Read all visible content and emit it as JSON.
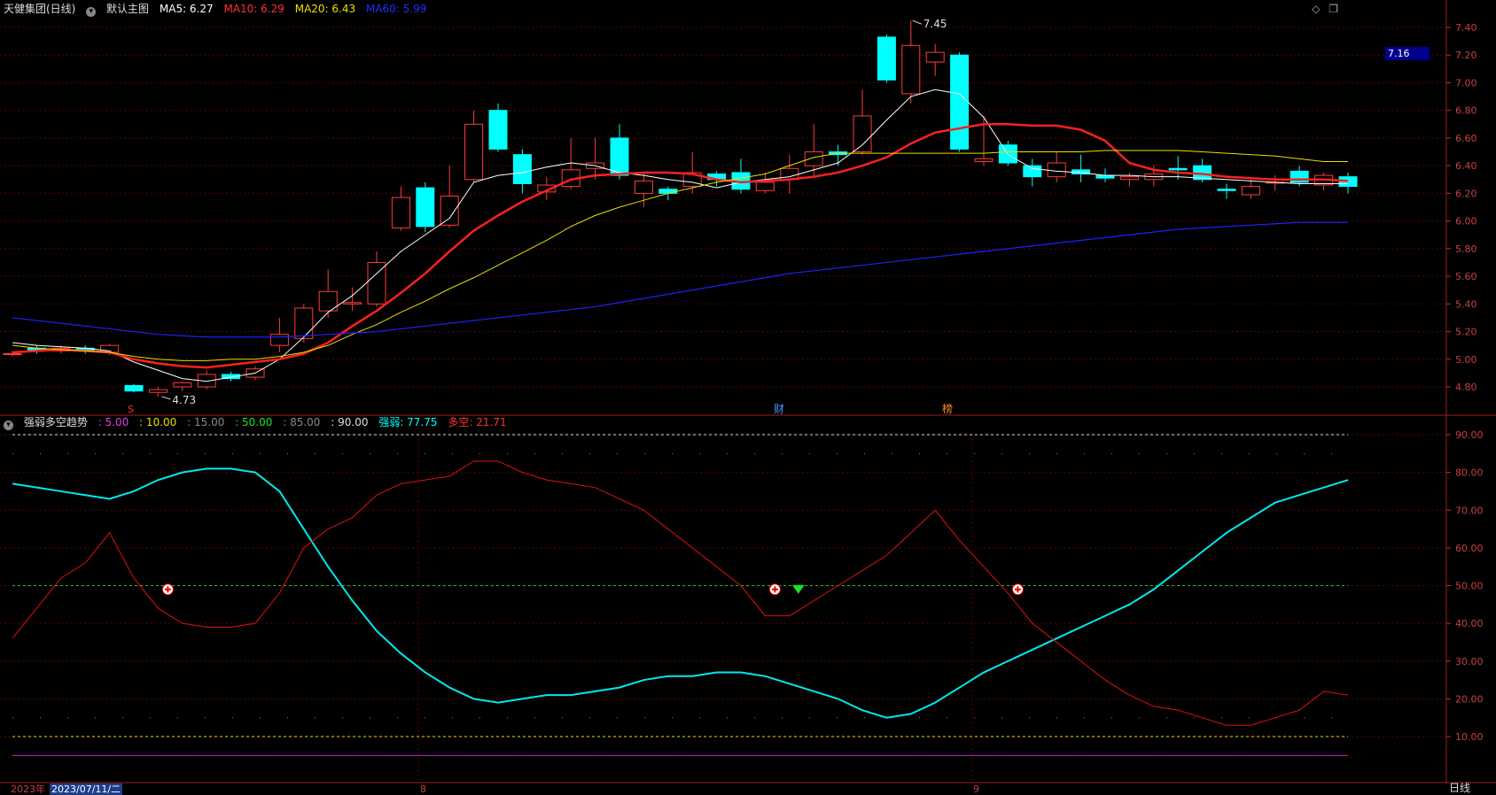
{
  "main_header": {
    "stock": "天健集团(日线)",
    "template": "默认主图",
    "ma5": "MA5: 6.27",
    "ma10": "MA10: 6.29",
    "ma20": "MA20: 6.43",
    "ma60": "MA60: 5.99"
  },
  "sub_header": {
    "title": "强弱多空趋势",
    "v1": ": 5.00",
    "v2": ": 10.00",
    "v3": ": 15.00",
    "v4": ": 50.00",
    "v5": ": 85.00",
    "v6": ": 90.00",
    "strength": "强弱: 77.75",
    "longshort": "多空: 21.71"
  },
  "bottom_axis": {
    "year_label": "2023年",
    "date_cursor": "2023/07/11/二",
    "aug": "8",
    "sep": "9"
  },
  "current_price": "7.16",
  "period_label": "日线",
  "corner_icons": [
    "diamond-icon",
    "restore-window-icon"
  ],
  "colors": {
    "up": "#ff3b3b",
    "down": "#00ffff",
    "ma5": "#ffffff",
    "ma10": "#ff2020",
    "ma20": "#e8e000",
    "ma60": "#2020ff"
  },
  "chart_data": [
    {
      "type": "candlestick",
      "ylim": [
        4.6,
        7.5
      ],
      "yticks": [
        "7.40",
        "7.20",
        "7.00",
        "6.80",
        "6.60",
        "6.40",
        "6.20",
        "6.00",
        "5.80",
        "5.60",
        "5.40",
        "5.20",
        "5.00",
        "4.80"
      ],
      "annotations": {
        "high": "7.45",
        "low": "4.73",
        "finance_marker": "财",
        "rank_marker": "榜",
        "s_marker": "S"
      },
      "candles": [
        [
          5.04,
          5.04,
          5.02,
          5.06
        ],
        [
          5.08,
          5.06,
          5.04,
          5.1
        ],
        [
          5.06,
          5.08,
          5.04,
          5.1
        ],
        [
          5.08,
          5.06,
          5.04,
          5.1
        ],
        [
          5.05,
          5.1,
          5.03,
          5.11
        ],
        [
          4.81,
          4.77,
          4.76,
          4.82
        ],
        [
          4.76,
          4.78,
          4.73,
          4.8
        ],
        [
          4.8,
          4.83,
          4.77,
          4.84
        ],
        [
          4.8,
          4.89,
          4.78,
          4.92
        ],
        [
          4.89,
          4.86,
          4.84,
          4.91
        ],
        [
          4.87,
          4.93,
          4.85,
          4.95
        ],
        [
          5.1,
          5.18,
          5.05,
          5.3
        ],
        [
          5.15,
          5.37,
          5.12,
          5.4
        ],
        [
          5.35,
          5.49,
          5.3,
          5.65
        ],
        [
          5.4,
          5.41,
          5.35,
          5.52
        ],
        [
          5.4,
          5.7,
          5.38,
          5.78
        ],
        [
          5.95,
          6.17,
          5.93,
          6.25
        ],
        [
          6.24,
          5.96,
          5.92,
          6.28
        ],
        [
          5.97,
          6.18,
          5.95,
          6.4
        ],
        [
          6.3,
          6.7,
          6.28,
          6.8
        ],
        [
          6.8,
          6.52,
          6.5,
          6.85
        ],
        [
          6.48,
          6.27,
          6.2,
          6.52
        ],
        [
          6.21,
          6.26,
          6.15,
          6.32
        ],
        [
          6.25,
          6.37,
          6.23,
          6.6
        ],
        [
          6.38,
          6.42,
          6.3,
          6.6
        ],
        [
          6.6,
          6.33,
          6.3,
          6.7
        ],
        [
          6.2,
          6.29,
          6.1,
          6.35
        ],
        [
          6.23,
          6.2,
          6.15,
          6.25
        ],
        [
          6.25,
          6.35,
          6.2,
          6.5
        ],
        [
          6.34,
          6.3,
          6.25,
          6.36
        ],
        [
          6.35,
          6.23,
          6.2,
          6.45
        ],
        [
          6.22,
          6.28,
          6.2,
          6.35
        ],
        [
          6.3,
          6.38,
          6.2,
          6.48
        ],
        [
          6.4,
          6.5,
          6.32,
          6.7
        ],
        [
          6.5,
          6.48,
          6.4,
          6.55
        ],
        [
          6.5,
          6.76,
          6.48,
          6.95
        ],
        [
          7.33,
          7.02,
          7.0,
          7.35
        ],
        [
          6.92,
          7.27,
          6.85,
          7.45
        ],
        [
          7.15,
          7.22,
          7.05,
          7.28
        ],
        [
          7.2,
          6.52,
          6.5,
          7.22
        ],
        [
          6.43,
          6.45,
          6.4,
          6.76
        ],
        [
          6.55,
          6.42,
          6.4,
          6.58
        ],
        [
          6.4,
          6.32,
          6.25,
          6.45
        ],
        [
          6.32,
          6.42,
          6.28,
          6.5
        ],
        [
          6.37,
          6.34,
          6.28,
          6.48
        ],
        [
          6.33,
          6.31,
          6.28,
          6.38
        ],
        [
          6.3,
          6.32,
          6.25,
          6.35
        ],
        [
          6.3,
          6.34,
          6.25,
          6.4
        ],
        [
          6.38,
          6.37,
          6.3,
          6.47
        ],
        [
          6.4,
          6.3,
          6.28,
          6.45
        ],
        [
          6.23,
          6.22,
          6.16,
          6.27
        ],
        [
          6.19,
          6.25,
          6.16,
          6.3
        ],
        [
          6.28,
          6.28,
          6.22,
          6.33
        ],
        [
          6.36,
          6.28,
          6.25,
          6.4
        ],
        [
          6.26,
          6.33,
          6.22,
          6.35
        ],
        [
          6.32,
          6.25,
          6.2,
          6.35
        ]
      ],
      "series": [
        {
          "name": "MA5",
          "values": [
            5.12,
            5.1,
            5.09,
            5.08,
            5.06,
            4.98,
            4.92,
            4.86,
            4.84,
            4.87,
            4.9,
            5.0,
            5.16,
            5.34,
            5.46,
            5.62,
            5.78,
            5.9,
            6.02,
            6.28,
            6.33,
            6.35,
            6.39,
            6.42,
            6.4,
            6.35,
            6.33,
            6.3,
            6.28,
            6.24,
            6.28,
            6.3,
            6.32,
            6.37,
            6.42,
            6.55,
            6.73,
            6.9,
            6.95,
            6.92,
            6.75,
            6.48,
            6.38,
            6.36,
            6.35,
            6.33,
            6.33,
            6.32,
            6.32,
            6.31,
            6.3,
            6.29,
            6.28,
            6.27,
            6.27,
            6.27
          ]
        },
        {
          "name": "MA10",
          "values": [
            5.05,
            5.06,
            5.07,
            5.06,
            5.05,
            5.0,
            4.97,
            4.95,
            4.94,
            4.96,
            4.98,
            5.0,
            5.04,
            5.12,
            5.24,
            5.35,
            5.48,
            5.62,
            5.78,
            5.93,
            6.04,
            6.14,
            6.22,
            6.3,
            6.33,
            6.34,
            6.35,
            6.35,
            6.34,
            6.3,
            6.28,
            6.29,
            6.3,
            6.32,
            6.35,
            6.4,
            6.46,
            6.56,
            6.64,
            6.67,
            6.7,
            6.7,
            6.69,
            6.69,
            6.66,
            6.58,
            6.42,
            6.37,
            6.35,
            6.34,
            6.32,
            6.31,
            6.3,
            6.3,
            6.3,
            6.29
          ]
        },
        {
          "name": "MA20",
          "values": [
            5.1,
            5.08,
            5.07,
            5.06,
            5.05,
            5.02,
            5.0,
            4.99,
            4.99,
            5.0,
            5.0,
            5.02,
            5.05,
            5.1,
            5.18,
            5.25,
            5.34,
            5.42,
            5.51,
            5.59,
            5.68,
            5.77,
            5.86,
            5.96,
            6.04,
            6.1,
            6.15,
            6.2,
            6.24,
            6.28,
            6.31,
            6.34,
            6.4,
            6.46,
            6.49,
            6.49,
            6.49,
            6.49,
            6.49,
            6.49,
            6.49,
            6.5,
            6.5,
            6.5,
            6.5,
            6.51,
            6.51,
            6.51,
            6.51,
            6.5,
            6.49,
            6.48,
            6.47,
            6.45,
            6.43,
            6.43
          ]
        },
        {
          "name": "MA60",
          "values": [
            5.3,
            5.28,
            5.26,
            5.24,
            5.22,
            5.2,
            5.18,
            5.17,
            5.16,
            5.16,
            5.16,
            5.16,
            5.17,
            5.18,
            5.19,
            5.2,
            5.22,
            5.24,
            5.26,
            5.28,
            5.3,
            5.32,
            5.34,
            5.36,
            5.38,
            5.41,
            5.44,
            5.47,
            5.5,
            5.53,
            5.56,
            5.59,
            5.62,
            5.64,
            5.66,
            5.68,
            5.7,
            5.72,
            5.74,
            5.76,
            5.78,
            5.8,
            5.82,
            5.84,
            5.86,
            5.88,
            5.9,
            5.92,
            5.94,
            5.95,
            5.96,
            5.97,
            5.98,
            5.99,
            5.99,
            5.99
          ]
        }
      ]
    },
    {
      "type": "line",
      "ylim": [
        0,
        95
      ],
      "yticks": [
        "90.00",
        "80.00",
        "70.00",
        "60.00",
        "50.00",
        "40.00",
        "30.00",
        "20.00",
        "10.00"
      ],
      "levels": [
        5,
        10,
        15,
        50,
        85,
        90
      ],
      "series": [
        {
          "name": "强弱",
          "values": [
            77,
            76,
            75,
            74,
            73,
            75,
            78,
            80,
            81,
            81,
            80,
            75,
            65,
            55,
            46,
            38,
            32,
            27,
            23,
            20,
            19,
            20,
            21,
            21,
            22,
            23,
            25,
            26,
            26,
            27,
            27,
            26,
            24,
            22,
            20,
            17,
            15,
            16,
            19,
            23,
            27,
            30,
            33,
            36,
            39,
            42,
            45,
            49,
            54,
            59,
            64,
            68,
            72,
            74,
            76,
            78
          ]
        },
        {
          "name": "多空",
          "values": [
            36,
            44,
            52,
            56,
            64,
            52,
            44,
            40,
            39,
            39,
            40,
            48,
            60,
            65,
            68,
            74,
            77,
            78,
            79,
            83,
            83,
            80,
            78,
            77,
            76,
            73,
            70,
            65,
            60,
            55,
            50,
            42,
            42,
            46,
            50,
            54,
            58,
            64,
            70,
            62,
            55,
            48,
            40,
            35,
            30,
            25,
            21,
            18,
            17,
            15,
            13,
            13,
            15,
            17,
            22,
            21
          ]
        }
      ],
      "markers": {
        "plus_indices": [
          6,
          31,
          41
        ],
        "down_arrow_index": 32
      }
    }
  ]
}
